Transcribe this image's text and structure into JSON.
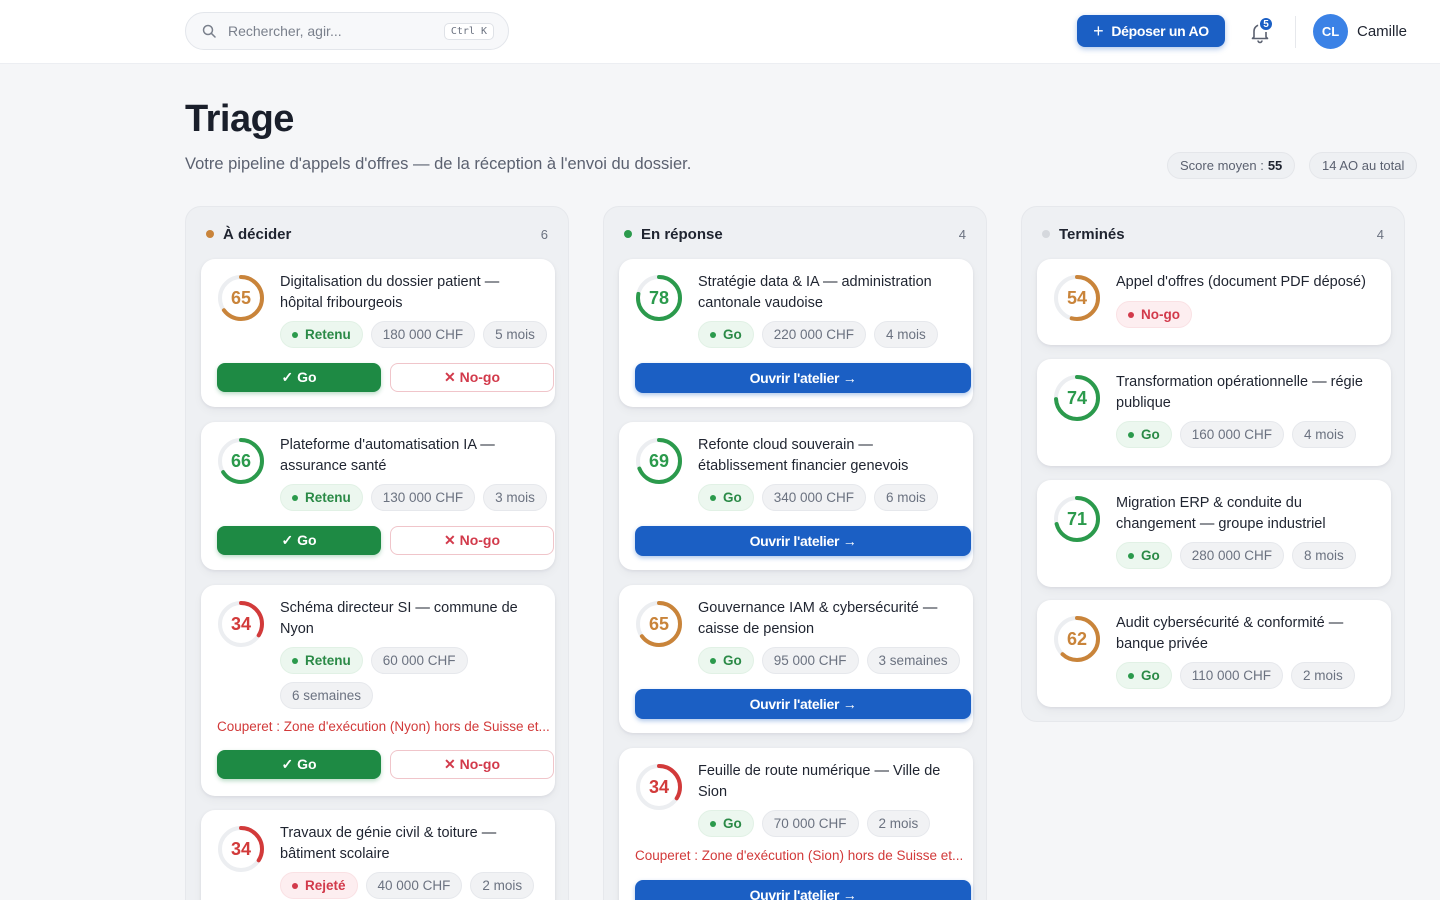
{
  "header": {
    "search_placeholder": "Rechercher, agir...",
    "search_shortcut": "Ctrl K",
    "deposit_label": "Déposer un AO",
    "notification_count": "5",
    "user_initials": "CL",
    "user_name": "Camille"
  },
  "page": {
    "title": "Triage",
    "subtitle": "Votre pipeline d'appels d'offres — de la réception à l'envoi du dossier.",
    "avg_score_label": "Score moyen :",
    "avg_score_value": "55",
    "total_label": "14 AO au total"
  },
  "actions": {
    "go": "✓ Go",
    "nogo": "✕ No-go",
    "open": "Ouvrir l'atelier →"
  },
  "columns": [
    {
      "title": "À décider",
      "count": "6",
      "dot_color": "#c9843a",
      "cards": [
        {
          "score": "65",
          "score_value": 65,
          "title": "Digitalisation du dossier patient — hôpital fribourgeois",
          "status": "Retenu",
          "status_kind": "green",
          "amount": "180 000 CHF",
          "duration": "5 mois"
        },
        {
          "score": "66",
          "score_value": 66,
          "title": "Plateforme d'automatisation IA — assurance santé",
          "status": "Retenu",
          "status_kind": "green",
          "amount": "130 000 CHF",
          "duration": "3 mois"
        },
        {
          "score": "34",
          "score_value": 34,
          "title": "Schéma directeur SI — commune de Nyon",
          "status": "Retenu",
          "status_kind": "green",
          "amount": "60 000 CHF",
          "duration": "6 semaines",
          "warning": "Couperet : Zone d'exécution (Nyon) hors de Suisse et..."
        },
        {
          "score": "34",
          "score_value": 34,
          "title": "Travaux de génie civil & toiture — bâtiment scolaire",
          "status": "Rejeté",
          "status_kind": "red",
          "amount": "40 000 CHF",
          "duration": "2 mois"
        }
      ]
    },
    {
      "title": "En réponse",
      "count": "4",
      "dot_color": "#2b9a4c",
      "cards": [
        {
          "score": "78",
          "score_value": 78,
          "title": "Stratégie data & IA — administration cantonale vaudoise",
          "status": "Go",
          "status_kind": "green",
          "amount": "220 000 CHF",
          "duration": "4 mois"
        },
        {
          "score": "69",
          "score_value": 69,
          "title": "Refonte cloud souverain — établissement financier genevois",
          "status": "Go",
          "status_kind": "green",
          "amount": "340 000 CHF",
          "duration": "6 mois"
        },
        {
          "score": "65",
          "score_value": 65,
          "title": "Gouvernance IAM & cybersécurité — caisse de pension",
          "status": "Go",
          "status_kind": "green",
          "amount": "95 000 CHF",
          "duration": "3 semaines"
        },
        {
          "score": "34",
          "score_value": 34,
          "title": "Feuille de route numérique — Ville de Sion",
          "status": "Go",
          "status_kind": "green",
          "amount": "70 000 CHF",
          "duration": "2 mois",
          "warning": "Couperet : Zone d'exécution (Sion) hors de Suisse et..."
        }
      ]
    },
    {
      "title": "Terminés",
      "count": "4",
      "dot_color": "#d5d8dd",
      "cards": [
        {
          "score": "54",
          "score_value": 54,
          "title": "Appel d'offres (document PDF déposé)",
          "status": "No-go",
          "status_kind": "red"
        },
        {
          "score": "74",
          "score_value": 74,
          "title": "Transformation opérationnelle — régie publique",
          "status": "Go",
          "status_kind": "green",
          "amount": "160 000 CHF",
          "duration": "4 mois"
        },
        {
          "score": "71",
          "score_value": 71,
          "title": "Migration ERP & conduite du changement — groupe industriel",
          "status": "Go",
          "status_kind": "green",
          "amount": "280 000 CHF",
          "duration": "8 mois"
        },
        {
          "score": "62",
          "score_value": 62,
          "title": "Audit cybersécurité & conformité — banque privée",
          "status": "Go",
          "status_kind": "green",
          "amount": "110 000 CHF",
          "duration": "2 mois"
        }
      ]
    }
  ],
  "colors": {
    "score_high": "#2b9a4c",
    "score_mid": "#c9843a",
    "score_low": "#d23a3a",
    "primary": "#1b5fc4",
    "go": "#1e8a44"
  }
}
